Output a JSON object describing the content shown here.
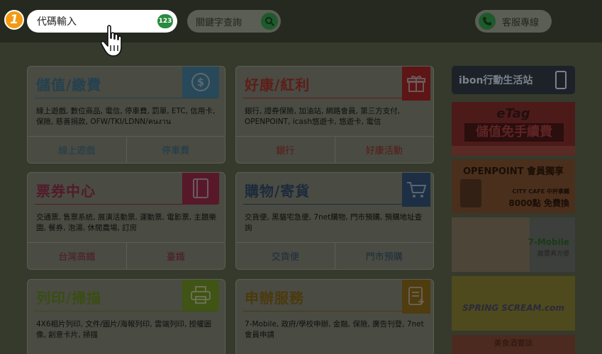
{
  "topbar": {
    "step_number": "1",
    "code_input_placeholder": "代碼輸入",
    "code_badge": "123",
    "keyword_search_label": "關鍵字查詢",
    "service_label": "客服專線"
  },
  "cards": [
    {
      "title": "儲值/繳費",
      "icon": "dollar-icon",
      "desc": "線上遊戲, 數位商品, 電信, 停車費, 罰單, ETC, 信用卡, 保險, 慈善捐款, OFW/TKI/LDNN/คนงาน",
      "links": [
        "線上遊戲",
        "停車費"
      ]
    },
    {
      "title": "好康/紅利",
      "icon": "gift-icon",
      "desc": "銀行, 證券保險, 加油站, 網路會員, 第三方支付, OPENPOINT, icash悠遊卡, 悠遊卡, 電信",
      "links": [
        "銀行",
        "好康活動"
      ]
    },
    {
      "title": "票券中心",
      "icon": "ticket-icon",
      "desc": "交通票, 售票系統, 展演活動票, 運動票, 電影票, 主題樂園, 餐券, 泡湯, 休閒農場, 訂房",
      "links": [
        "台灣高鐵",
        "臺鐵"
      ]
    },
    {
      "title": "購物/寄貨",
      "icon": "cart-icon",
      "desc": "交貨便, 黑貓宅急便, 7net購物, 門市預購, 預購地址查詢",
      "links": [
        "交貨便",
        "門市預購"
      ]
    },
    {
      "title": "列印/掃描",
      "icon": "printer-icon",
      "desc": "4X6相片列印, 文件/圖片/海報列印, 雲端列印, 授權圖像, 創意卡片, 掃描",
      "links": []
    },
    {
      "title": "申辦服務",
      "icon": "form-icon",
      "desc": "7-Mobile, 政府/學校申辦, 金融, 保險, 廣告刊登, 7net會員申請",
      "links": []
    }
  ],
  "sidebar": {
    "header": "ibon行動生活站",
    "banners": {
      "etag": {
        "line1": "eTag",
        "line2": "儲值免手續費"
      },
      "openpoint": {
        "line1": "OPENPOINT 會員獨享",
        "line2": "CITY CAFE 中杯拿鐵",
        "line3": "8000點 免費換"
      },
      "mobile": {
        "line1": "7-Mobile",
        "line2": "繳費真方便"
      },
      "spring": {
        "line1": "SPRING SCREAM.com"
      },
      "food": {
        "line1": "美食酒饗誌"
      }
    }
  },
  "colors": {
    "overlay_bg": "#353a2c",
    "step_badge": "#f39a14",
    "code_badge": "#2a8a3f"
  }
}
